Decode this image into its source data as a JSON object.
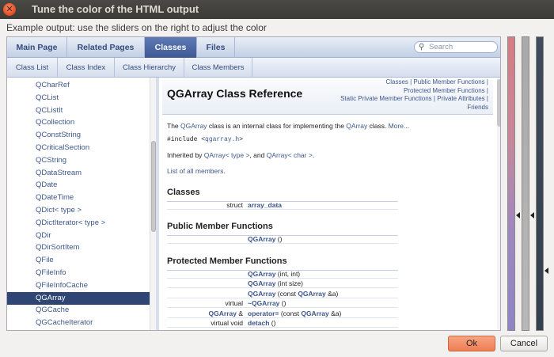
{
  "window": {
    "title": "Tune the color of the HTML output"
  },
  "description": "Example output: use the sliders on the right to adjust the color",
  "tabs": [
    "Main Page",
    "Related Pages",
    "Classes",
    "Files"
  ],
  "active_tab": "Classes",
  "search": {
    "placeholder": "Search"
  },
  "subtabs": [
    "Class List",
    "Class Index",
    "Class Hierarchy",
    "Class Members"
  ],
  "nav": {
    "items": [
      "QCharRef",
      "QCList",
      "QCListIt",
      "QCollection",
      "QConstString",
      "QCriticalSection",
      "QCString",
      "QDataStream",
      "QDate",
      "QDateTime",
      "QDict< type >",
      "QDictIterator< type >",
      "QDir",
      "QDirSortItem",
      "QFile",
      "QFileInfo",
      "QFileInfoCache",
      "QGArray",
      "QGCache",
      "QGCacheIterator"
    ],
    "selected": "QGArray"
  },
  "content": {
    "title": "QGArray Class Reference",
    "summary_links": {
      "classes": "Classes",
      "sep1": " | ",
      "public_funcs": "Public Member Functions",
      "sep2": " | ",
      "protected_funcs": "Protected Member Functions",
      "sep3": " | ",
      "static_private": "Static Private Member Functions",
      "sep4": " | ",
      "private_attrs": "Private Attributes",
      "sep5": " | ",
      "friends": "Friends"
    },
    "intro": {
      "the": "The ",
      "class1": "QGArray",
      "mid": " class is an internal class for implementing the ",
      "class2": "QArray",
      "end": " class. ",
      "more": "More..."
    },
    "include": {
      "prefix": "#include <",
      "file": "qgarray.h",
      "suffix": ">"
    },
    "inherited": {
      "prefix": "Inherited by ",
      "a": "QArray< type >",
      "mid": ", and ",
      "b": "QArray< char >",
      "end": "."
    },
    "members_link": "List of all members.",
    "sections": {
      "classes": "Classes",
      "public": "Public Member Functions",
      "protected": "Protected Member Functions"
    },
    "classes_rows": [
      {
        "left": "struct",
        "name": "array_data",
        "args": ""
      }
    ],
    "public_rows": [
      {
        "left": "",
        "name": "QGArray",
        "args": " ()"
      }
    ],
    "protected_rows": [
      {
        "left": "",
        "name": "QGArray",
        "args": " (int, int)"
      },
      {
        "left": "",
        "name": "QGArray",
        "args": " (int size)"
      },
      {
        "left": "",
        "name": "QGArray",
        "args": " (const ",
        "name2": "QGArray",
        "args2": " &a)"
      },
      {
        "left": "virtual",
        "name": "~QGArray",
        "args": " ()"
      },
      {
        "left_link": "QGArray",
        "left_suffix": " &",
        "name": "operator=",
        "args": " (const ",
        "name2": "QGArray",
        "args2": " &a)"
      },
      {
        "left": "virtual void",
        "name": "detach",
        "args": " ()"
      }
    ]
  },
  "sliders": {
    "colors": [
      "#d57d84",
      "#8e84c4",
      "#a9a9a9",
      "#3b4a5c"
    ]
  },
  "buttons": {
    "ok": "Ok",
    "cancel": "Cancel"
  }
}
